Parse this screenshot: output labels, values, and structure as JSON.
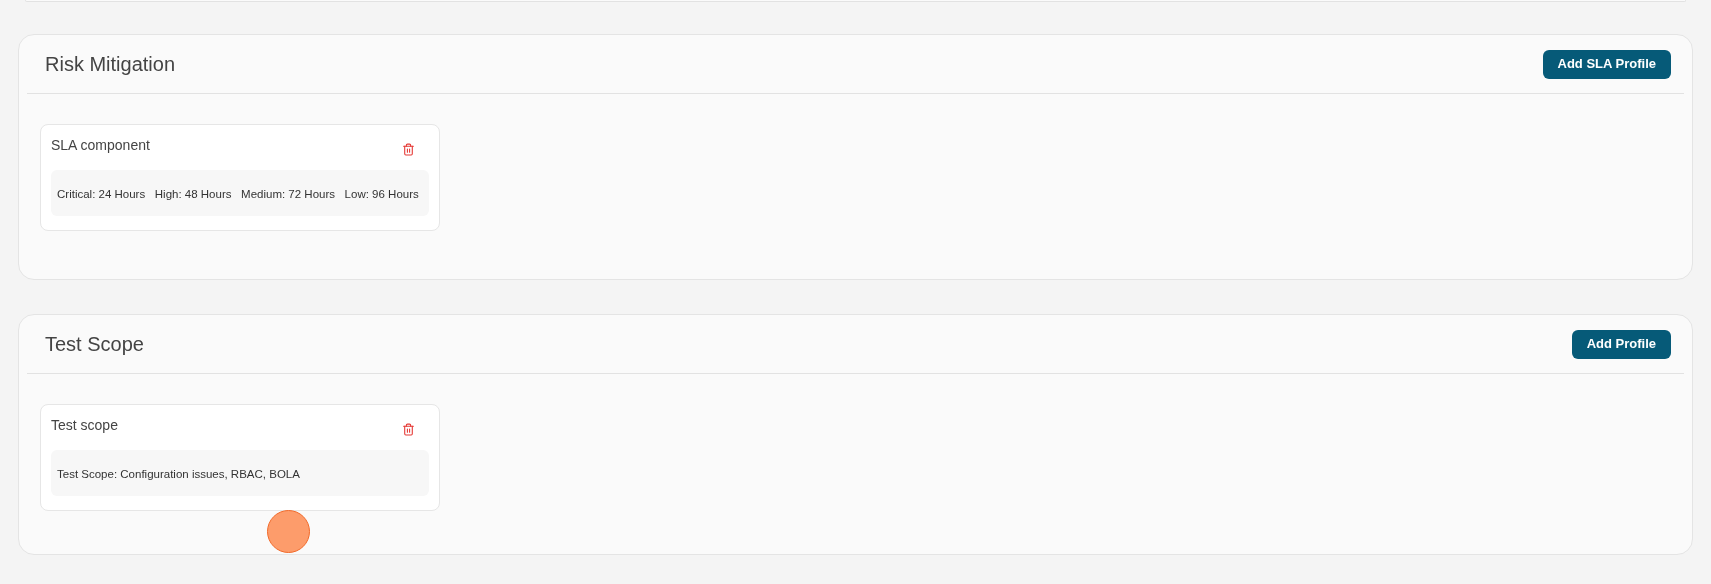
{
  "sections": [
    {
      "title": "Risk Mitigation",
      "button": "Add SLA Profile",
      "cards": [
        {
          "title": "SLA component",
          "detail": "Critical: 24 Hours   High: 48 Hours   Medium: 72 Hours   Low: 96 Hours"
        }
      ]
    },
    {
      "title": "Test Scope",
      "button": "Add Profile",
      "cards": [
        {
          "title": "Test scope",
          "detail": "Test Scope: Configuration issues, RBAC, BOLA"
        }
      ]
    }
  ]
}
